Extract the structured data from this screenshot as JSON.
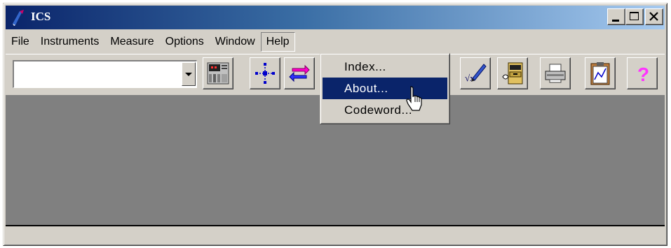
{
  "window": {
    "title": "ICS",
    "controls": {
      "minimize": "_",
      "maximize": "□",
      "close": "×"
    }
  },
  "menubar": {
    "items": [
      "File",
      "Instruments",
      "Measure",
      "Options",
      "Window",
      "Help"
    ],
    "open_item": "Help"
  },
  "toolbar": {
    "combo_value": "",
    "tools": [
      "instrument-panel-icon",
      "network-icon",
      "swap-arrows-icon",
      "formula-pen-icon",
      "file-cabinet-icon",
      "printer-icon",
      "clipboard-chart-icon",
      "help-question-icon"
    ]
  },
  "help_menu": {
    "items": [
      "Index...",
      "About...",
      "Codeword..."
    ],
    "selected": "About..."
  },
  "colors": {
    "title_gradient_start": "#0a246a",
    "title_gradient_end": "#a6caf0",
    "face": "#d4d0c8",
    "client": "#808080",
    "highlight": "#0a246a"
  }
}
